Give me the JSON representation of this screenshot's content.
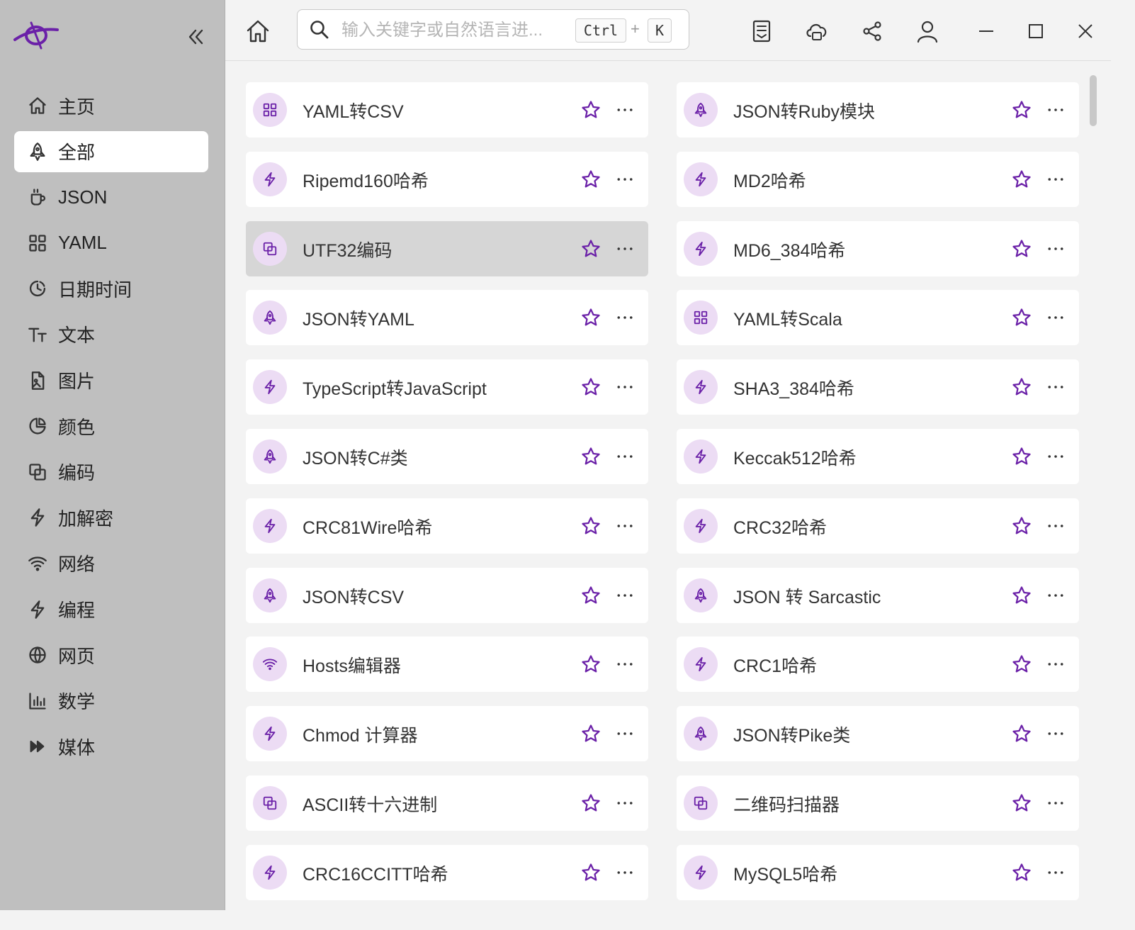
{
  "colors": {
    "accent": "#6b21a8",
    "badge_bg": "#ecdcf4",
    "sidebar_bg": "#bfbfbf",
    "content_bg": "#f3f3f3"
  },
  "sidebar": {
    "logo": "app-logo",
    "collapse_icon": "chevrons-left-icon",
    "items": [
      {
        "label": "主页",
        "icon": "home-icon",
        "active": false
      },
      {
        "label": "全部",
        "icon": "rocket-icon",
        "active": true
      },
      {
        "label": "JSON",
        "icon": "cup-icon",
        "active": false
      },
      {
        "label": "YAML",
        "icon": "grid-icon",
        "active": false
      },
      {
        "label": "日期时间",
        "icon": "clock-icon",
        "active": false
      },
      {
        "label": "文本",
        "icon": "text-icon",
        "active": false
      },
      {
        "label": "图片",
        "icon": "image-file-icon",
        "active": false
      },
      {
        "label": "颜色",
        "icon": "pie-icon",
        "active": false
      },
      {
        "label": "编码",
        "icon": "copy-icon",
        "active": false
      },
      {
        "label": "加解密",
        "icon": "bolt-icon",
        "active": false
      },
      {
        "label": "网络",
        "icon": "wifi-icon",
        "active": false
      },
      {
        "label": "编程",
        "icon": "bolt-icon",
        "active": false
      },
      {
        "label": "网页",
        "icon": "globe-icon",
        "active": false
      },
      {
        "label": "数学",
        "icon": "chart-icon",
        "active": false
      },
      {
        "label": "媒体",
        "icon": "fast-forward-icon",
        "active": false
      }
    ]
  },
  "topbar": {
    "search": {
      "placeholder": "输入关键字或自然语言进...",
      "value": ""
    },
    "shortcut": {
      "ctrl": "Ctrl",
      "plus": "+",
      "key": "K"
    },
    "actions": [
      "document-icon",
      "cloud-icon",
      "share-icon",
      "user-icon"
    ],
    "window_controls": [
      "minimize-icon",
      "maximize-icon",
      "close-icon"
    ]
  },
  "tools": {
    "left": [
      {
        "label": "YAML转CSV",
        "icon": "grid-icon"
      },
      {
        "label": "Ripemd160哈希",
        "icon": "bolt-icon"
      },
      {
        "label": "UTF32编码",
        "icon": "copy-icon",
        "hover": true
      },
      {
        "label": "JSON转YAML",
        "icon": "rocket-icon"
      },
      {
        "label": "TypeScript转JavaScript",
        "icon": "bolt-icon"
      },
      {
        "label": "JSON转C#类",
        "icon": "rocket-icon"
      },
      {
        "label": "CRC81Wire哈希",
        "icon": "bolt-icon"
      },
      {
        "label": "JSON转CSV",
        "icon": "rocket-icon"
      },
      {
        "label": "Hosts编辑器",
        "icon": "wifi-icon"
      },
      {
        "label": "Chmod 计算器",
        "icon": "bolt-icon"
      },
      {
        "label": "ASCII转十六进制",
        "icon": "copy-icon"
      },
      {
        "label": "CRC16CCITT哈希",
        "icon": "bolt-icon"
      }
    ],
    "right": [
      {
        "label": "JSON转Ruby模块",
        "icon": "rocket-icon"
      },
      {
        "label": "MD2哈希",
        "icon": "bolt-icon"
      },
      {
        "label": "MD6_384哈希",
        "icon": "bolt-icon"
      },
      {
        "label": "YAML转Scala",
        "icon": "grid-icon"
      },
      {
        "label": "SHA3_384哈希",
        "icon": "bolt-icon"
      },
      {
        "label": "Keccak512哈希",
        "icon": "bolt-icon"
      },
      {
        "label": "CRC32哈希",
        "icon": "bolt-icon"
      },
      {
        "label": "JSON 转 Sarcastic",
        "icon": "rocket-icon"
      },
      {
        "label": "CRC1哈希",
        "icon": "bolt-icon"
      },
      {
        "label": "JSON转Pike类",
        "icon": "rocket-icon"
      },
      {
        "label": "二维码扫描器",
        "icon": "copy-icon"
      },
      {
        "label": "MySQL5哈希",
        "icon": "bolt-icon"
      }
    ]
  }
}
